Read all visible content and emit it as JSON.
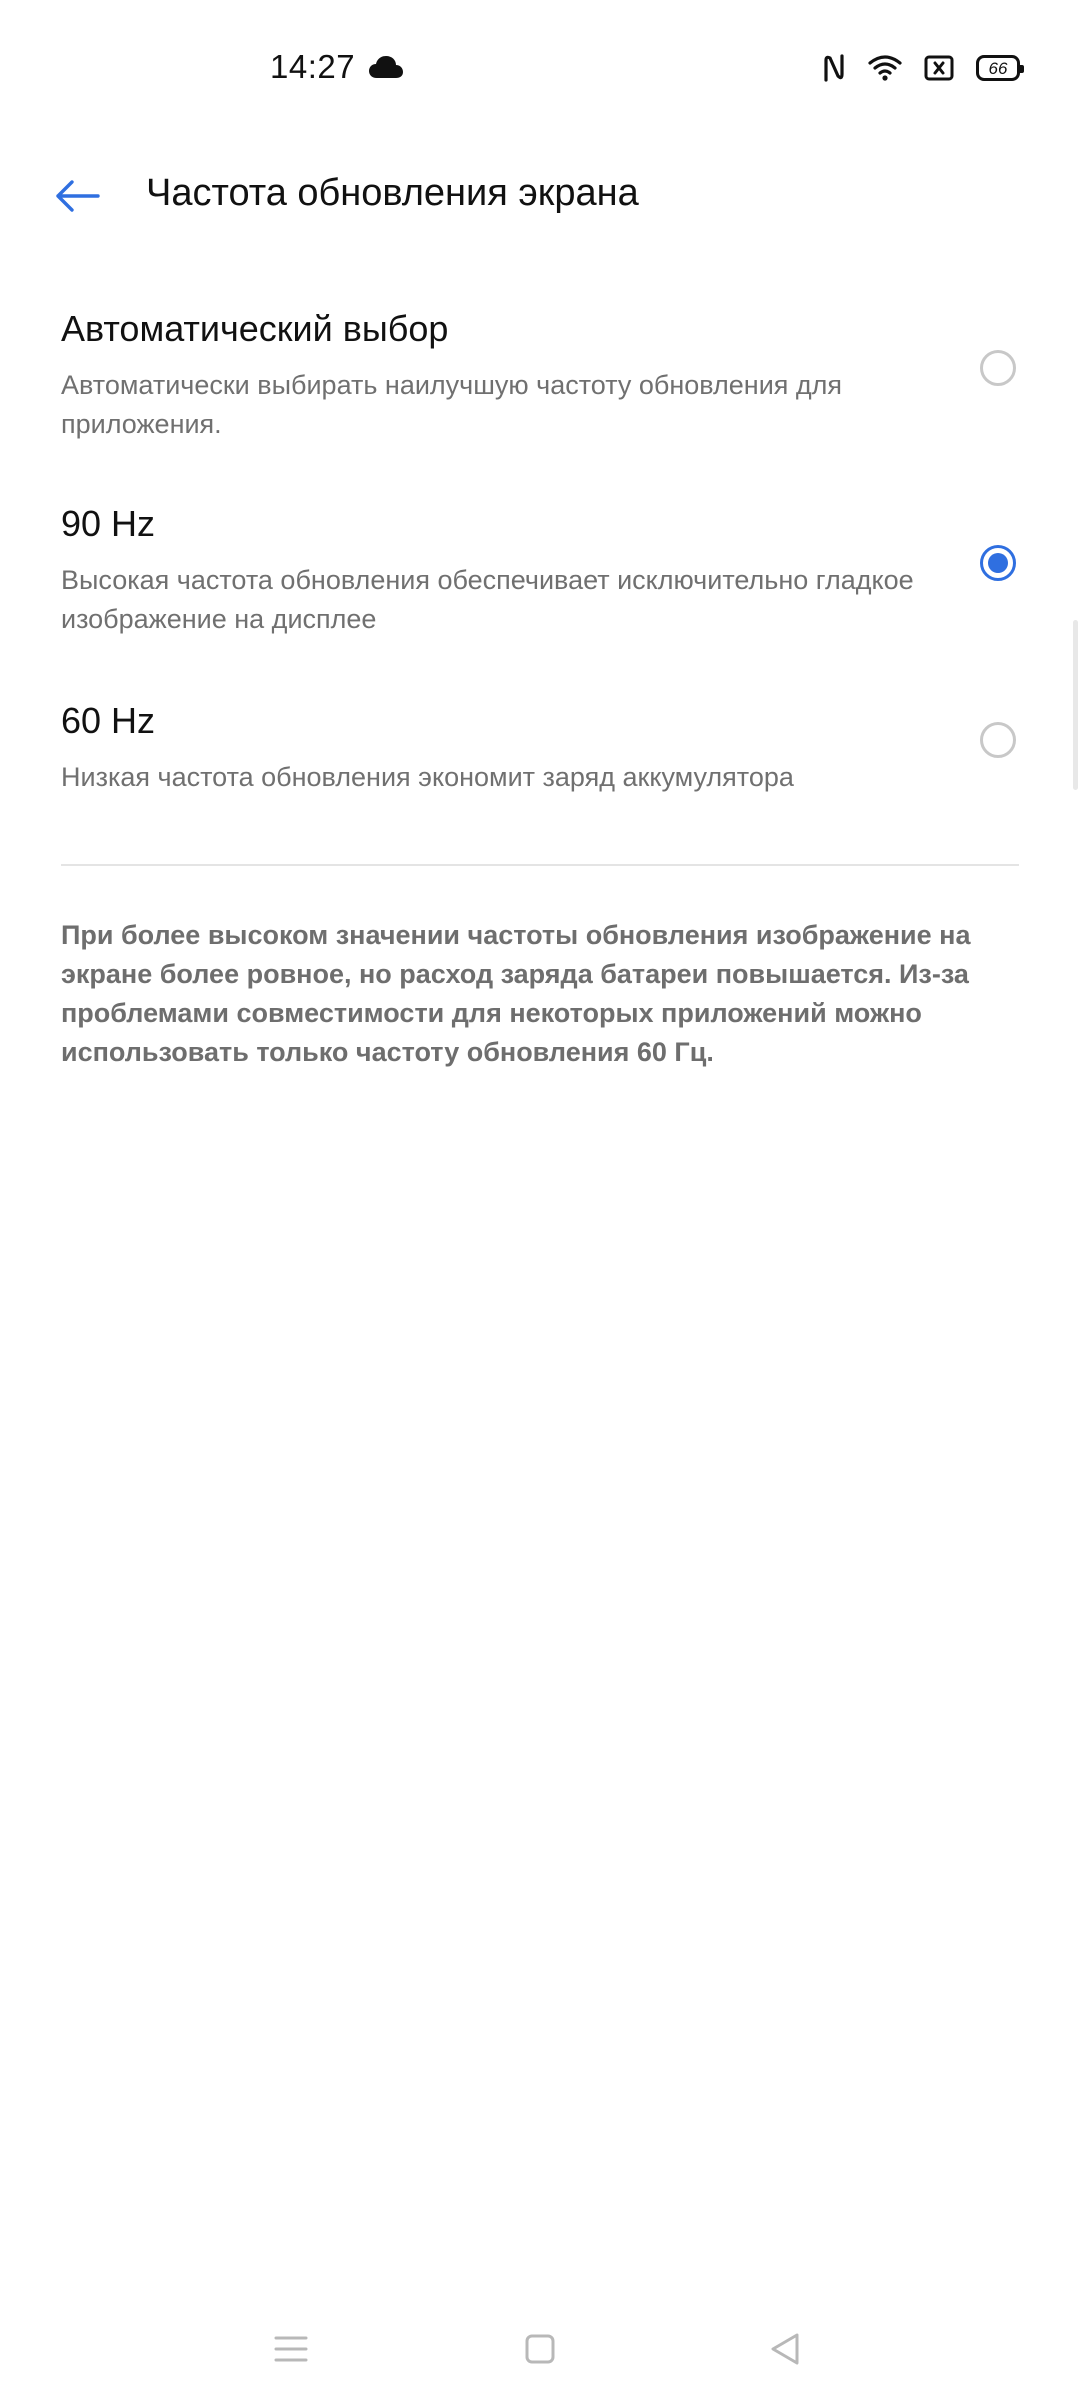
{
  "status_bar": {
    "time": "14:27",
    "battery_level": "66",
    "icons": [
      "cloud-icon",
      "nfc-icon",
      "wifi-icon",
      "no-sim-icon",
      "battery-icon"
    ]
  },
  "header": {
    "title": "Частота обновления экрана",
    "back_icon": "back-arrow-icon"
  },
  "options": [
    {
      "title": "Автоматический выбор",
      "description": "Автоматически выбирать наилучшую частоту обновления для приложения.",
      "selected": false
    },
    {
      "title": "90 Hz",
      "description": "Высокая частота обновления обеспечивает исключительно гладкое изображение на дисплее",
      "selected": true
    },
    {
      "title": "60 Hz",
      "description": "Низкая частота обновления экономит заряд аккумулятора",
      "selected": false
    }
  ],
  "footnote": "При более высоком значении частоты обновления изображение на экране более ровное, но расход заряда батареи повышается. Из-за проблемами совместимости для некоторых приложений можно использовать только частоту обновления 60 Гц.",
  "nav_bar": {
    "icons": [
      "menu-icon",
      "home-icon",
      "back-icon"
    ]
  },
  "colors": {
    "accent": "#2f6fe0",
    "text_primary": "#111111",
    "text_secondary": "#707070"
  }
}
